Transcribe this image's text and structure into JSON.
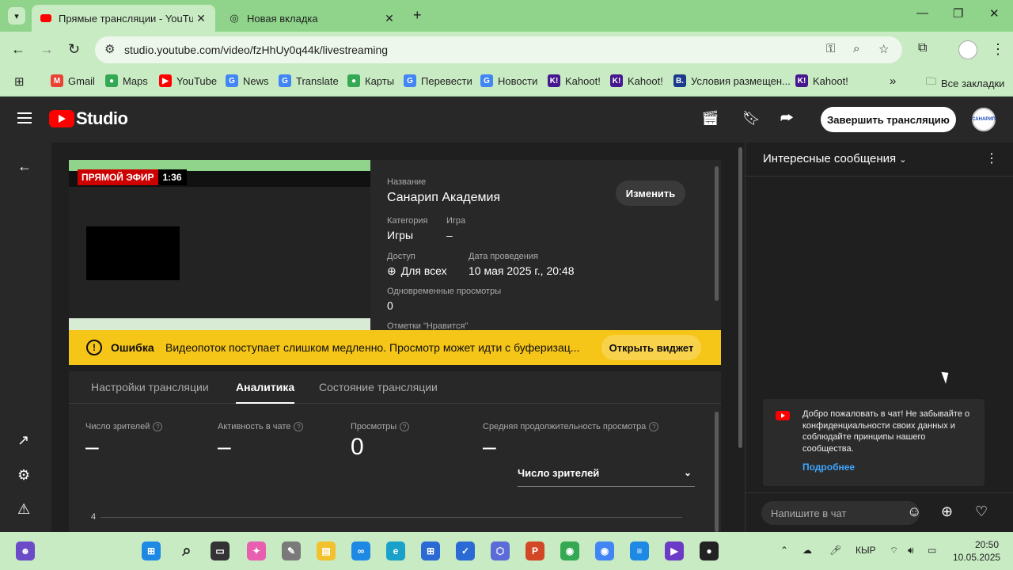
{
  "browser": {
    "tabs": [
      {
        "title": "Прямые трансляции - YouTube"
      },
      {
        "title": "Новая вкладка"
      }
    ],
    "url": "studio.youtube.com/video/fzHhUy0q44k/livestreaming",
    "bookmarks": [
      "Gmail",
      "Maps",
      "YouTube",
      "News",
      "Translate",
      "Карты",
      "Перевести",
      "Новости",
      "Kahoot!",
      "Kahoot!",
      "Условия размещен...",
      "Kahoot!"
    ],
    "all_bookmarks": "Все закладки"
  },
  "studio": {
    "logo": "Studio",
    "end_stream": "Завершить трансляцию",
    "avatar_text": "САНАРИП"
  },
  "preview": {
    "live_label": "ПРЯМОЙ ЭФИР",
    "time": "1:36"
  },
  "meta": {
    "name_label": "Название",
    "name_value": "Санарип Академия",
    "edit_button": "Изменить",
    "category_label": "Категория",
    "category_value": "Игры",
    "game_label": "Игра",
    "game_value": "–",
    "access_label": "Доступ",
    "access_value": "Для всех",
    "date_label": "Дата проведения",
    "date_value": "10 мая 2025 г., 20:48",
    "concurrent_label": "Одновременные просмотры",
    "concurrent_value": "0",
    "likes_label": "Отметки \"Нравится\""
  },
  "warning": {
    "title": "Ошибка",
    "message": "Видеопоток поступает слишком медленно. Просмотр может идти с буферизац...",
    "button": "Открыть виджет"
  },
  "tabs": [
    "Настройки трансляции",
    "Аналитика",
    "Состояние трансляции"
  ],
  "analytics": {
    "stats": [
      {
        "label": "Число зрителей",
        "value": "–"
      },
      {
        "label": "Активность в чате",
        "value": "–"
      },
      {
        "label": "Просмотры",
        "value": "0"
      },
      {
        "label": "Средняя продолжительность просмотра",
        "value": "–"
      }
    ],
    "metric_select": "Число зрителей",
    "axis_tick": "4"
  },
  "chat": {
    "title": "Интересные сообщения",
    "welcome": "Добро пожаловать в чат! Не забывайте о конфиденциальности своих данных и соблюдайте принципы нашего сообщества.",
    "more": "Подробнее",
    "input_placeholder": "Напишите в чат"
  },
  "taskbar": {
    "lang": "КЫР",
    "time": "20:50",
    "date": "10.05.2025"
  }
}
